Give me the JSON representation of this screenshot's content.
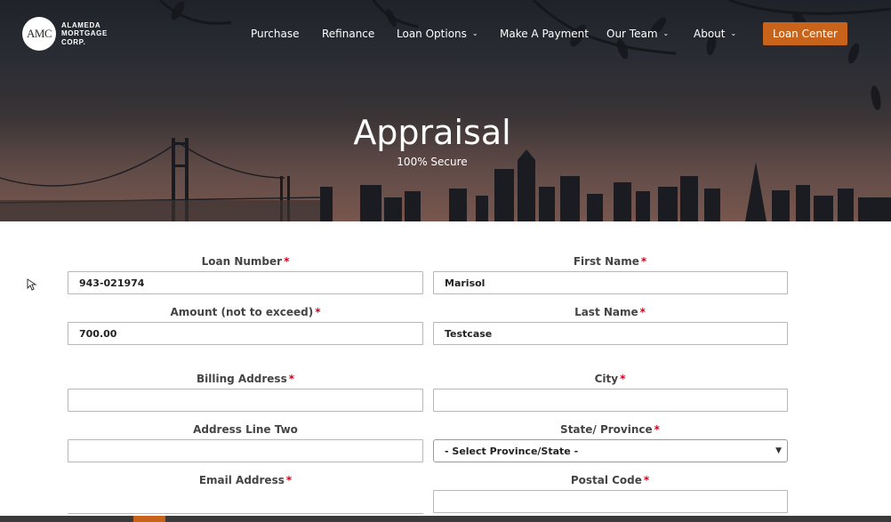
{
  "logo": {
    "mark": "AMC",
    "lines": [
      "ALAMEDA",
      "MORTGAGE",
      "CORP."
    ]
  },
  "nav": {
    "items": [
      {
        "label": "Purchase",
        "has_menu": false
      },
      {
        "label": "Refinance",
        "has_menu": false
      },
      {
        "label": "Loan Options",
        "has_menu": true
      },
      {
        "label": "Make A Payment",
        "has_menu": false
      },
      {
        "label": "Our Team",
        "has_menu": true
      },
      {
        "label": "About",
        "has_menu": true
      }
    ],
    "cta": "Loan Center",
    "chevron_icon": "chevron-down-icon"
  },
  "hero": {
    "title": "Appraisal",
    "subtitle": "100% Secure"
  },
  "form": {
    "required_marker": "*",
    "fields": {
      "loan_number": {
        "label": "Loan Number",
        "value": "943-021974"
      },
      "first_name": {
        "label": "First Name",
        "value": "Marisol"
      },
      "amount": {
        "label": "Amount (not to exceed)",
        "value": "700.00"
      },
      "last_name": {
        "label": "Last Name",
        "value": "Testcase"
      },
      "billing_address": {
        "label": "Billing Address",
        "value": ""
      },
      "city": {
        "label": "City",
        "value": ""
      },
      "address_line_two": {
        "label": "Address Line Two",
        "value": ""
      },
      "state": {
        "label": "State/ Province",
        "value": "- Select Province/State -"
      },
      "email": {
        "label": "Email Address",
        "value": ""
      },
      "postal_code": {
        "label": "Postal Code",
        "value": ""
      }
    }
  },
  "colors": {
    "accent": "#c8631b",
    "required": "#d0021b",
    "label": "#444444"
  }
}
